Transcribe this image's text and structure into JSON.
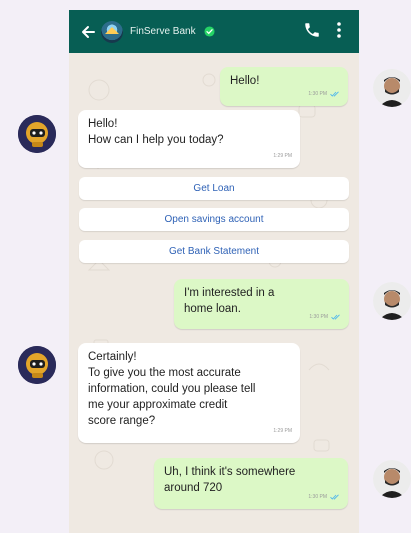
{
  "header": {
    "title": "FinServe Bank",
    "back_icon": "arrow-left-icon",
    "verified_icon": "verified-check-icon",
    "call_icon": "phone-icon",
    "menu_icon": "more-vertical-icon"
  },
  "messages": [
    {
      "direction": "out",
      "text": "Hello!",
      "time": "1:30 PM"
    },
    {
      "direction": "in",
      "text": "Hello!\nHow can I help you today?",
      "time": "1:29 PM"
    },
    {
      "direction": "out",
      "text": "I'm interested in a\nhome loan.",
      "time": "1:30 PM"
    },
    {
      "direction": "in",
      "text": "Certainly!\nTo give you the most accurate\ninformation, could you please tell\nme your approximate credit\nscore range?",
      "time": "1:29 PM"
    },
    {
      "direction": "out",
      "text": "Uh, I think it's somewhere\naround 720",
      "time": "1:30 PM"
    }
  ],
  "quick_replies": [
    "Get Loan",
    "Open savings account",
    "Get Bank Statement"
  ],
  "colors": {
    "header": "#075e54",
    "outgoing_bubble": "#dcf8c6",
    "incoming_bubble": "#ffffff",
    "quick_reply_text": "#2f62b6",
    "page_background": "#f3eff7"
  }
}
